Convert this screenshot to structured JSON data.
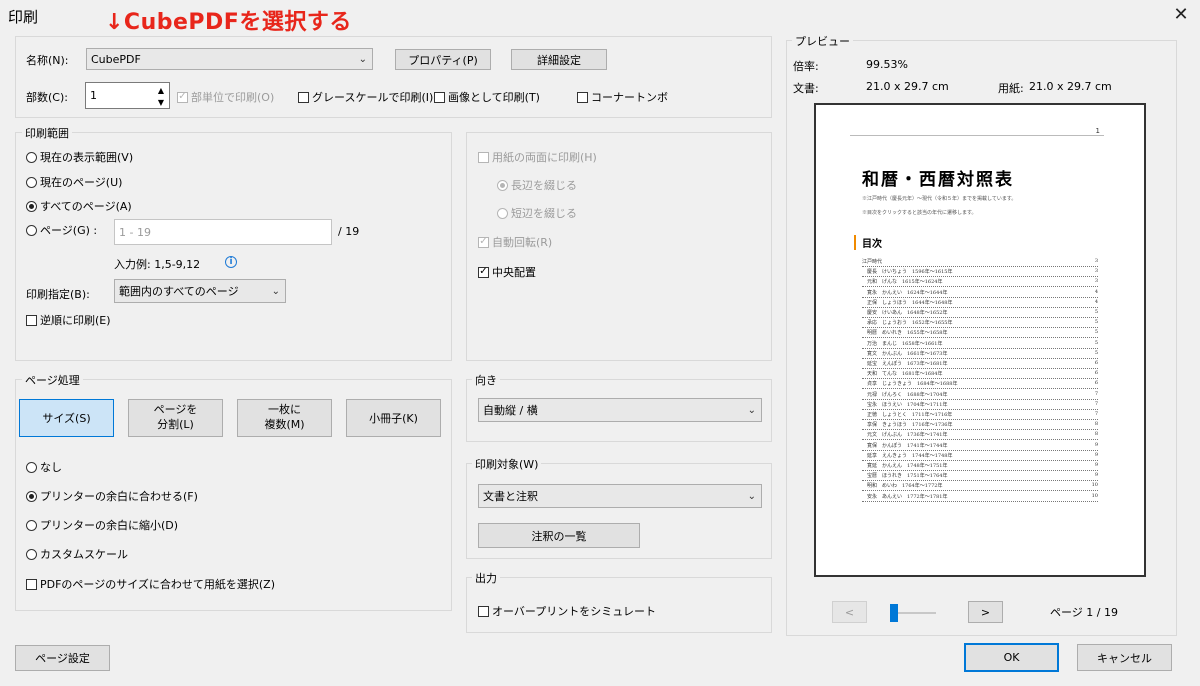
{
  "window": {
    "title": "印刷",
    "close": "✕"
  },
  "annotation": "↓CubePDFを選択する",
  "printer": {
    "name_label": "名称(N):",
    "name_value": "CubePDF",
    "properties_button": "プロパティ(P)",
    "advanced_button": "詳細設定",
    "copies_label": "部数(C):",
    "copies_value": "1",
    "collate": "部単位で印刷(O)",
    "grayscale": "グレースケールで印刷(I)",
    "as_image": "画像として印刷(T)",
    "corner_marks": "コーナートンボ"
  },
  "range": {
    "legend": "印刷範囲",
    "current_view": "現在の表示範囲(V)",
    "current_page": "現在のページ(U)",
    "all_pages": "すべてのページ(A)",
    "pages": "ページ(G) :",
    "pages_placeholder": "1 - 19",
    "pages_total": "/ 19",
    "example": "入力例: 1,5-9,12",
    "subset_label": "印刷指定(B):",
    "subset_value": "範囲内のすべてのページ",
    "reverse": "逆順に印刷(E)"
  },
  "duplex": {
    "both_sides": "用紙の両面に印刷(H)",
    "long_edge": "長辺を綴じる",
    "short_edge": "短辺を綴じる",
    "auto_rotate": "自動回転(R)",
    "center": "中央配置"
  },
  "handling": {
    "legend": "ページ処理",
    "size_btn": "サイズ(S)",
    "split_btn_1": "ページを",
    "split_btn_2": "分割(L)",
    "multi_btn_1": "一枚に",
    "multi_btn_2": "複数(M)",
    "booklet_btn": "小冊子(K)",
    "none": "なし",
    "fit": "プリンターの余白に合わせる(F)",
    "shrink": "プリンターの余白に縮小(D)",
    "custom": "カスタムスケール",
    "choose_paper": "PDFのページのサイズに合わせて用紙を選択(Z)"
  },
  "orientation": {
    "legend": "向き",
    "value": "自動縦 / 横"
  },
  "content": {
    "legend": "印刷対象(W)",
    "value": "文書と注釈",
    "summarize_btn": "注釈の一覧"
  },
  "output": {
    "legend": "出力",
    "simulate_overprint": "オーバープリントをシミュレート"
  },
  "preview": {
    "legend": "プレビュー",
    "zoom_label": "倍率:",
    "zoom_value": "99.53%",
    "doc_label": "文書:",
    "doc_value": "21.0 x 29.7 cm",
    "paper_label": "用紙:",
    "paper_value": "21.0 x 29.7 cm",
    "prev": "<",
    "next": ">",
    "page_indicator": "ページ 1 / 19",
    "page_number": "1",
    "doc_title": "和暦・西暦対照表",
    "doc_sub1": "※江戸時代（慶長元年）～現代（令和５年）までを掲載しています。",
    "doc_sub2": "※目次をクリックすると該当の年代に遷移します。",
    "toc_title": "目次",
    "toc": [
      {
        "text": "江戸時代",
        "page": "3"
      },
      {
        "text": "　慶長　けいちょう　1596年～1615年",
        "page": "3"
      },
      {
        "text": "　元和　げんな　1615年～1624年",
        "page": "3"
      },
      {
        "text": "　寛永　かんえい　1624年～1644年",
        "page": "4"
      },
      {
        "text": "　正保　しょうほう　1644年～1648年",
        "page": "4"
      },
      {
        "text": "　慶安　けいあん　1648年～1652年",
        "page": "5"
      },
      {
        "text": "　承応　じょうおう　1652年～1655年",
        "page": "5"
      },
      {
        "text": "　明暦　めいれき　1655年～1658年",
        "page": "5"
      },
      {
        "text": "　万治　まんじ　1658年～1661年",
        "page": "5"
      },
      {
        "text": "　寛文　かんぶん　1661年～1673年",
        "page": "5"
      },
      {
        "text": "　延宝　えんぽう　1673年～1681年",
        "page": "6"
      },
      {
        "text": "　天和　てんな　1681年～1684年",
        "page": "6"
      },
      {
        "text": "　貞享　じょうきょう　1684年～1688年",
        "page": "6"
      },
      {
        "text": "　元禄　げんろく　1688年～1704年",
        "page": "7"
      },
      {
        "text": "　宝永　ほうえい　1704年～1711年",
        "page": "7"
      },
      {
        "text": "　正徳　しょうとく　1711年～1716年",
        "page": "7"
      },
      {
        "text": "　享保　きょうほう　1716年～1736年",
        "page": "8"
      },
      {
        "text": "　元文　げんぶん　1736年～1741年",
        "page": "8"
      },
      {
        "text": "　寛保　かんぽう　1741年～1744年",
        "page": "9"
      },
      {
        "text": "　延享　えんきょう　1744年～1748年",
        "page": "9"
      },
      {
        "text": "　寛延　かんえん　1748年～1751年",
        "page": "9"
      },
      {
        "text": "　宝暦　ほうれき　1751年～1764年",
        "page": "9"
      },
      {
        "text": "　明和　めいわ　1764年～1772年",
        "page": "10"
      },
      {
        "text": "　安永　あんえい　1772年～1781年",
        "page": "10"
      }
    ]
  },
  "footer": {
    "page_setup": "ページ設定",
    "ok": "OK",
    "cancel": "キャンセル"
  }
}
